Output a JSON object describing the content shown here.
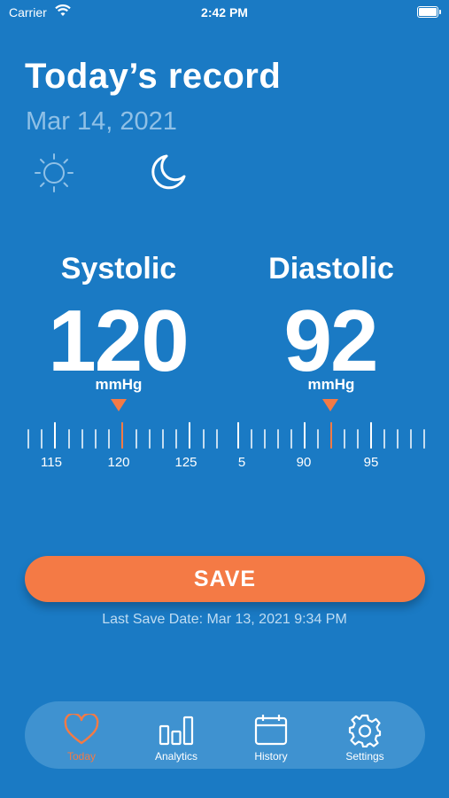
{
  "status_bar": {
    "carrier": "Carrier",
    "time": "2:42 PM"
  },
  "header": {
    "title": "Today’s record",
    "date": "Mar 14, 2021"
  },
  "time_of_day": {
    "options": [
      "sun-icon",
      "moon-icon"
    ],
    "selected": "moon-icon"
  },
  "systolic": {
    "label": "Systolic",
    "value": "120",
    "unit": "mmHg",
    "tick_labels": [
      "115",
      "120",
      "125"
    ]
  },
  "diastolic": {
    "label": "Diastolic",
    "value": "92",
    "unit": "mmHg",
    "tick_labels": [
      "5",
      "90",
      "95"
    ]
  },
  "actions": {
    "save_label": "SAVE",
    "last_save": "Last Save Date: Mar 13, 2021 9:34 PM"
  },
  "tabbar": {
    "tabs": [
      {
        "label": "Today",
        "icon": "heart-icon",
        "active": true
      },
      {
        "label": "Analytics",
        "icon": "bar-chart-icon",
        "active": false
      },
      {
        "label": "History",
        "icon": "calendar-icon",
        "active": false
      },
      {
        "label": "Settings",
        "icon": "gear-icon",
        "active": false
      }
    ]
  },
  "colors": {
    "background": "#1a7ac4",
    "accent": "#f47a45",
    "tabbar": "#3f92d0"
  }
}
